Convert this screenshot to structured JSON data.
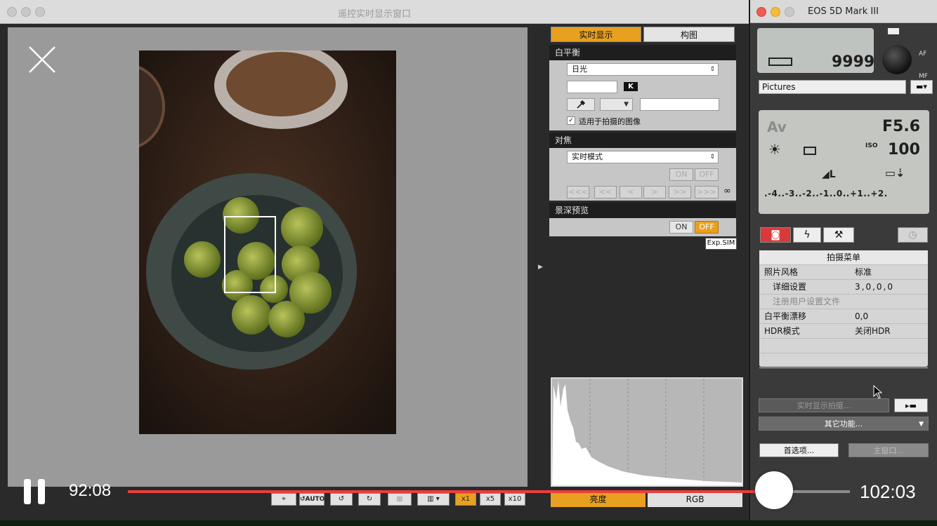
{
  "main_window": {
    "title": "遥控实时显示窗口"
  },
  "panel": {
    "tabs": [
      "实时显示",
      "构图"
    ],
    "white_balance": {
      "heading": "白平衡",
      "mode": "日光",
      "kelvin_value": "",
      "kelvin_badge": "K",
      "apply_label": "适用于拍摄的图像"
    },
    "focus": {
      "heading": "对焦",
      "mode": "实时模式",
      "on": "ON",
      "off": "OFF",
      "steps": [
        "<<<",
        "<<",
        "<",
        ">",
        ">>",
        ">>>"
      ],
      "infinity": "∞"
    },
    "dof": {
      "heading": "景深预览",
      "on": "ON",
      "off": "OFF",
      "exp_sim": "Exp.SIM"
    }
  },
  "histogram": {
    "tabs": [
      "亮度",
      "RGB"
    ],
    "active_tab": "亮度"
  },
  "toolbar": {
    "auto_label": "AUTO",
    "zoom": [
      "x1",
      "x5",
      "x10"
    ]
  },
  "camera_window": {
    "title": "EOS 5D Mark III",
    "shots_remaining": "9999",
    "af_label": "AF",
    "mf_label": "MF",
    "save_folder": "Pictures",
    "mode": "Av",
    "aperture": "F5.6",
    "iso_label": "ISO",
    "iso": "100",
    "exposure_scale": ".-4..-3..-2..-1..0..+1..+2.",
    "menu": {
      "title": "拍摄菜单",
      "rows": [
        {
          "label": "照片风格",
          "value": "标准"
        },
        {
          "label": "详细设置",
          "value": "3,0,0,0"
        },
        {
          "label": "注册用户设置文件",
          "value": ""
        },
        {
          "label": "白平衡漂移",
          "value": "0,0"
        },
        {
          "label": "HDR模式",
          "value": "关闭HDR"
        }
      ]
    },
    "live_shoot_btn": "实时显示拍摄...",
    "other_functions": "其它功能...",
    "preferences": "首选项...",
    "main_window_btn": "主窗口..."
  },
  "player": {
    "elapsed": "92:08",
    "total": "102:03",
    "progress": 0.895,
    "accent": "#ef3b3b"
  }
}
